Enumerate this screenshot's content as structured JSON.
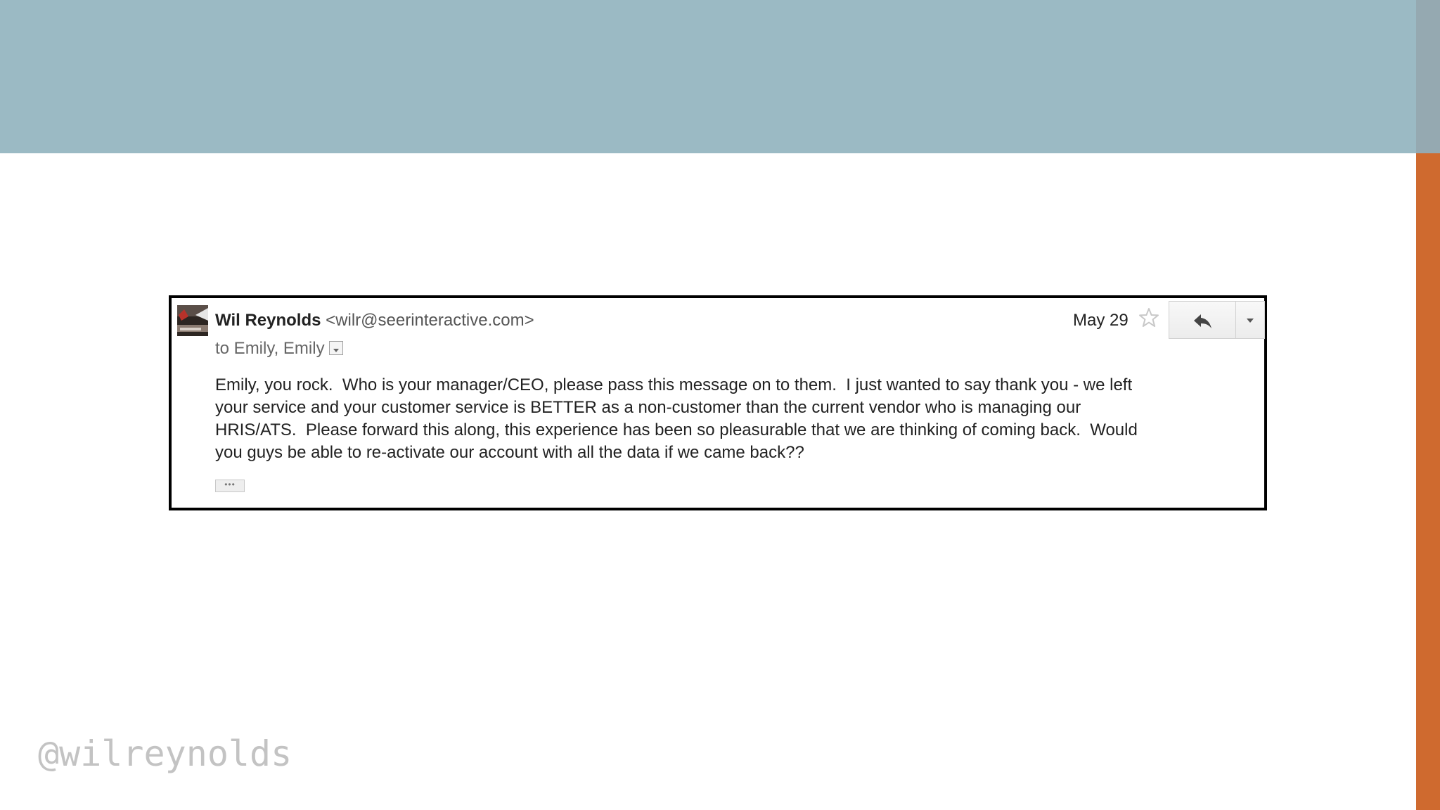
{
  "email": {
    "sender_name": "Wil Reynolds",
    "sender_email": "<wilr@seerinteractive.com>",
    "recipients": "to Emily, Emily",
    "date": "May 29",
    "body": "Emily, you rock.  Who is your manager/CEO, please pass this message on to them.  I just wanted to say thank you - we left\nyour service and your customer service is BETTER as a non-customer than the current vendor who is managing our\nHRIS/ATS.  Please forward this along, this experience has been so pleasurable that we are thinking of coming back.  Would\nyou guys be able to re-activate our account with all the data if we came back??",
    "ellipsis": "•••"
  },
  "footer": {
    "handle": "@wilreynolds"
  },
  "icons": {
    "star": "star-icon",
    "reply": "reply-icon",
    "more": "chevron-down-icon"
  },
  "colors": {
    "top_band": "#9bbac4",
    "accent_orange": "#cf6a2f",
    "handle_text": "#c3c3c3"
  }
}
